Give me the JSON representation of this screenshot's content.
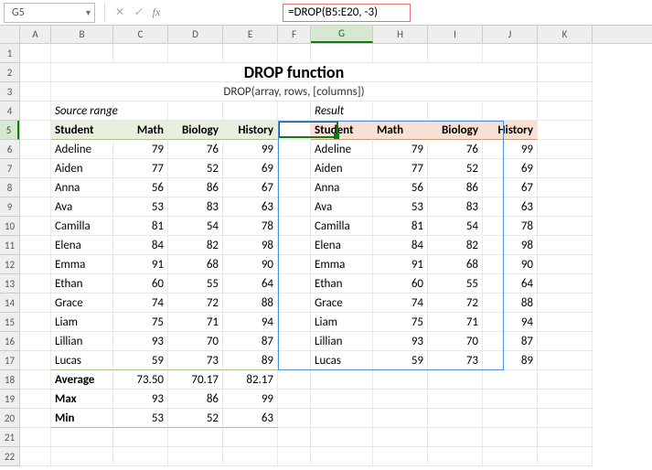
{
  "colors": {
    "accent_green": "#107c10",
    "spill_blue": "#4d8edb",
    "formula_outline": "#e57373"
  },
  "formula_bar": {
    "cell_ref": "G5",
    "formula": "=DROP(B5:E20, -3)"
  },
  "columns": [
    "A",
    "B",
    "C",
    "D",
    "E",
    "F",
    "G",
    "H",
    "I",
    "J",
    "K"
  ],
  "selected_col": "G",
  "selected_row": 5,
  "row_count": 22,
  "title": "DROP function",
  "subtitle": "DROP(array, rows, [columns])",
  "source_label": "Source range",
  "result_label": "Result",
  "headers": [
    "Student",
    "Math",
    "Biology",
    "History"
  ],
  "rows": [
    {
      "name": "Adeline",
      "m": "79",
      "b": "76",
      "h": "99"
    },
    {
      "name": "Aiden",
      "m": "77",
      "b": "52",
      "h": "69"
    },
    {
      "name": "Anna",
      "m": "56",
      "b": "86",
      "h": "67"
    },
    {
      "name": "Ava",
      "m": "53",
      "b": "83",
      "h": "63"
    },
    {
      "name": "Camilla",
      "m": "81",
      "b": "54",
      "h": "78"
    },
    {
      "name": "Elena",
      "m": "84",
      "b": "82",
      "h": "98"
    },
    {
      "name": "Emma",
      "m": "91",
      "b": "68",
      "h": "90"
    },
    {
      "name": "Ethan",
      "m": "60",
      "b": "55",
      "h": "64"
    },
    {
      "name": "Grace",
      "m": "74",
      "b": "72",
      "h": "88"
    },
    {
      "name": "Liam",
      "m": "75",
      "b": "71",
      "h": "94"
    },
    {
      "name": "Lillian",
      "m": "93",
      "b": "70",
      "h": "87"
    },
    {
      "name": "Lucas",
      "m": "59",
      "b": "73",
      "h": "89"
    }
  ],
  "summary": [
    {
      "label": "Average",
      "m": "73.50",
      "b": "70.17",
      "h": "82.17"
    },
    {
      "label": "Max",
      "m": "93",
      "b": "86",
      "h": "99"
    },
    {
      "label": "Min",
      "m": "53",
      "b": "52",
      "h": "63"
    }
  ],
  "chart_data": {
    "type": "table",
    "title": "DROP function demo: source range B5:E20, result of =DROP(B5:E20,-3) in G5",
    "columns": [
      "Student",
      "Math",
      "Biology",
      "History"
    ],
    "source_rows": [
      [
        "Adeline",
        79,
        76,
        99
      ],
      [
        "Aiden",
        77,
        52,
        69
      ],
      [
        "Anna",
        56,
        86,
        67
      ],
      [
        "Ava",
        53,
        83,
        63
      ],
      [
        "Camilla",
        81,
        54,
        78
      ],
      [
        "Elena",
        84,
        82,
        98
      ],
      [
        "Emma",
        91,
        68,
        90
      ],
      [
        "Ethan",
        60,
        55,
        64
      ],
      [
        "Grace",
        74,
        72,
        88
      ],
      [
        "Liam",
        75,
        71,
        94
      ],
      [
        "Lillian",
        93,
        70,
        87
      ],
      [
        "Lucas",
        59,
        73,
        89
      ],
      [
        "Average",
        73.5,
        70.17,
        82.17
      ],
      [
        "Max",
        93,
        86,
        99
      ],
      [
        "Min",
        53,
        52,
        63
      ]
    ],
    "result_rows": [
      [
        "Student",
        "Math",
        "Biology",
        "History"
      ],
      [
        "Adeline",
        79,
        76,
        99
      ],
      [
        "Aiden",
        77,
        52,
        69
      ],
      [
        "Anna",
        56,
        86,
        67
      ],
      [
        "Ava",
        53,
        83,
        63
      ],
      [
        "Camilla",
        81,
        54,
        78
      ],
      [
        "Elena",
        84,
        82,
        98
      ],
      [
        "Emma",
        91,
        68,
        90
      ],
      [
        "Ethan",
        60,
        55,
        64
      ],
      [
        "Grace",
        74,
        72,
        88
      ],
      [
        "Liam",
        75,
        71,
        94
      ],
      [
        "Lillian",
        93,
        70,
        87
      ],
      [
        "Lucas",
        59,
        73,
        89
      ]
    ]
  }
}
